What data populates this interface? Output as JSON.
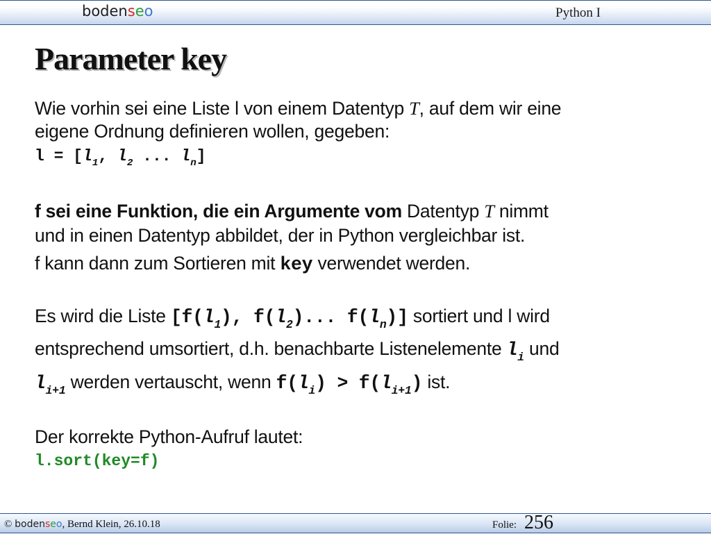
{
  "header": {
    "logo": {
      "b": "boden",
      "s": "s",
      "e": "e",
      "o": "o"
    },
    "course": "Python I"
  },
  "title": "Parameter key",
  "para1": {
    "line1_a": "Wie vorhin sei eine Liste l von einem Datentyp ",
    "line1_type": "T",
    "line1_b": ", auf dem wir eine",
    "line2": "eigene Ordnung definieren wollen, gegeben:",
    "code_a": "l = [",
    "code_l1": "l",
    "code_s1": "1",
    "code_sep1": ", ",
    "code_l2": "l",
    "code_s2": "2",
    "code_dots": " ... ",
    "code_ln": "l",
    "code_sn": "n",
    "code_end": "]"
  },
  "para2": {
    "bold": "f sei eine Funktion, die ein Argumente vom",
    "a": " Datentyp ",
    "type": "T",
    "b": " nimmt",
    "line2": "und in einen Datentyp abbildet, der in Python vergleichbar ist.",
    "line3_a": "f kann dann zum Sortieren mit ",
    "line3_code": "key",
    "line3_b": " verwendet werden."
  },
  "para3": {
    "l1_a": "Es wird die Liste ",
    "c_open": "[f(",
    "c_l1": "l",
    "c_s1": "1",
    "c_mid1": "), f(",
    "c_l2": "l",
    "c_s2": "2",
    "c_mid2": ")... f(",
    "c_ln": "l",
    "c_sn": "n",
    "c_close": ")]",
    "l1_b": " sortiert und l wird",
    "l2_a": "entsprechend umsortiert, d.h. benachbarte  Listenelemente ",
    "l2_li": "l",
    "l2_si": "i",
    "l2_b": " und",
    "l3_li": "l",
    "l3_si": "i+1",
    "l3_a": " werden vertauscht, wenn ",
    "l3_f1": "f(",
    "l3_l1": "l",
    "l3_s1": "i",
    "l3_gt": ") >  f(",
    "l3_l2": "l",
    "l3_s2": "i+1",
    "l3_close": ")",
    "l3_b": " ist."
  },
  "para4": {
    "line1": "Der korrekte Python-Aufruf lautet:",
    "code": "l.sort(key=f)"
  },
  "footer": {
    "copyright": "© ",
    "author": ", Bernd Klein, 26.10.18",
    "folie_label": "Folie:",
    "folie_number": "256"
  }
}
